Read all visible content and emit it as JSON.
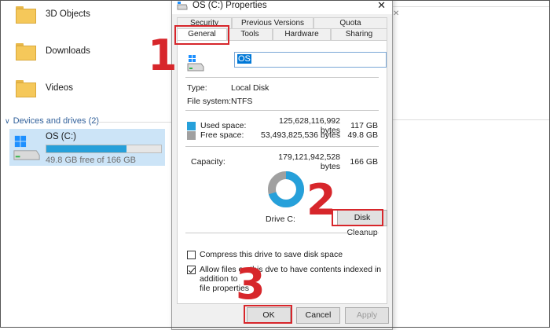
{
  "explorer": {
    "items": [
      {
        "label": "3D Objects",
        "icon": "3d-objects-folder-icon"
      },
      {
        "label": "Downloads",
        "icon": "downloads-folder-icon"
      },
      {
        "label": "Videos",
        "icon": "videos-folder-icon"
      }
    ],
    "devices_header": "Devices and drives (2)",
    "drive": {
      "name": "OS (C:)",
      "free_text": "49.8 GB free of 166 GB",
      "used_fraction": 0.7
    }
  },
  "dialog": {
    "title": "OS (C:) Properties",
    "tabs_top": [
      "Security",
      "Previous Versions",
      "Quota"
    ],
    "tabs_bottom": [
      "General",
      "Tools",
      "Hardware",
      "Sharing"
    ],
    "active_tab": "General",
    "name_value": "OS",
    "type_label": "Type:",
    "type_value": "Local Disk",
    "fs_label": "File system:",
    "fs_value": "NTFS",
    "used_label": "Used space:",
    "used_bytes": "125,628,116,992 bytes",
    "used_gb": "117 GB",
    "free_label": "Free space:",
    "free_bytes": "53,493,825,536 bytes",
    "free_gb": "49.8 GB",
    "capacity_label": "Capacity:",
    "capacity_bytes": "179,121,942,528 bytes",
    "capacity_gb": "166 GB",
    "drive_label": "Drive C:",
    "disk_cleanup": "Disk Cleanup",
    "compress_label": "Compress this drive to save disk space",
    "compress_checked": false,
    "index_label_1": "Allow files on this d",
    "index_label_2": "ve to have contents indexed in addition to",
    "index_label_3": "file properties",
    "index_checked": true,
    "ok": "OK",
    "cancel": "Cancel",
    "apply": "Apply"
  },
  "annotations": {
    "step1": "1",
    "step2": "2",
    "step3": "3"
  },
  "colors": {
    "used": "#26a0da",
    "free": "#a0a0a0",
    "highlight": "#d7262b"
  }
}
